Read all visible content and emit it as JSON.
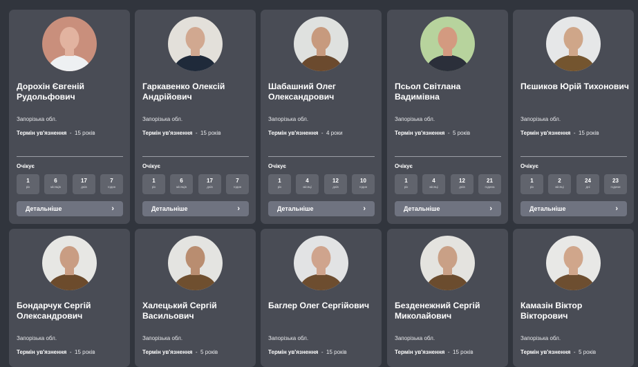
{
  "region_label": "Запорізька обл.",
  "term_label": "Термін ув'язнення",
  "term_separator": "-",
  "awaiting_label": "Очікує",
  "details_label": "Детальніше",
  "chevron_glyph": "›",
  "people": [
    {
      "name": "Дорохін Євгеній Рудольфович",
      "term": "15 років",
      "avatar": {
        "bg": "#c98f7c",
        "skin": "#e2b3a0",
        "shirt": "#eef0f2"
      },
      "wait": [
        {
          "v": "1",
          "u": "рік"
        },
        {
          "v": "6",
          "u": "місяців"
        },
        {
          "v": "17",
          "u": "днів"
        },
        {
          "v": "7",
          "u": "годин"
        }
      ]
    },
    {
      "name": "Гаркавенко Олексій Андрійович",
      "term": "15 років",
      "avatar": {
        "bg": "#e3e0da",
        "skin": "#d1a890",
        "shirt": "#1f2a3a"
      },
      "wait": [
        {
          "v": "1",
          "u": "рік"
        },
        {
          "v": "6",
          "u": "місяців"
        },
        {
          "v": "17",
          "u": "днів"
        },
        {
          "v": "7",
          "u": "годин"
        }
      ]
    },
    {
      "name": "Шабашний Олег Олександрович",
      "term": "4 роки",
      "avatar": {
        "bg": "#dfe1df",
        "skin": "#c79a7e",
        "shirt": "#6b4a2e"
      },
      "wait": [
        {
          "v": "1",
          "u": "рік"
        },
        {
          "v": "4",
          "u": "місяці"
        },
        {
          "v": "12",
          "u": "днів"
        },
        {
          "v": "10",
          "u": "годин"
        }
      ]
    },
    {
      "name": "Псьол Світлана Вадимівна",
      "term": "5 років",
      "avatar": {
        "bg": "#b7d39d",
        "skin": "#d39a80",
        "shirt": "#2b2f3a"
      },
      "wait": [
        {
          "v": "1",
          "u": "рік"
        },
        {
          "v": "4",
          "u": "місяці"
        },
        {
          "v": "12",
          "u": "днів"
        },
        {
          "v": "21",
          "u": "година"
        }
      ]
    },
    {
      "name": "Пєшиков Юрій Тихонович",
      "term": "15 років",
      "avatar": {
        "bg": "#e6e7e8",
        "skin": "#cfa689",
        "shirt": "#74552f"
      },
      "wait": [
        {
          "v": "1",
          "u": "рік"
        },
        {
          "v": "2",
          "u": "місяці"
        },
        {
          "v": "24",
          "u": "дні"
        },
        {
          "v": "23",
          "u": "години"
        }
      ]
    },
    {
      "name": "Бондарчук Сергій Олександрович",
      "term": "15 років",
      "avatar": {
        "bg": "#e7e7e4",
        "skin": "#c99d83",
        "shirt": "#6c4b2c"
      },
      "wait": []
    },
    {
      "name": "Халецький Сергій Васильович",
      "term": "5 років",
      "avatar": {
        "bg": "#e4e4e1",
        "skin": "#b98d70",
        "shirt": "#6f4f2f"
      },
      "wait": []
    },
    {
      "name": "Баглер Олег Сергійович",
      "term": "15 років",
      "avatar": {
        "bg": "#e2e3e4",
        "skin": "#cfa48d",
        "shirt": "#6d4d2f"
      },
      "wait": []
    },
    {
      "name": "Безденежний Сергій Миколайович",
      "term": "15 років",
      "avatar": {
        "bg": "#e4e3df",
        "skin": "#c9a086",
        "shirt": "#6b4c2e"
      },
      "wait": []
    },
    {
      "name": "Камазін Віктор Вікторович",
      "term": "5 років",
      "avatar": {
        "bg": "#e8e8e6",
        "skin": "#d0a68b",
        "shirt": "#6d4e30"
      },
      "wait": []
    }
  ]
}
